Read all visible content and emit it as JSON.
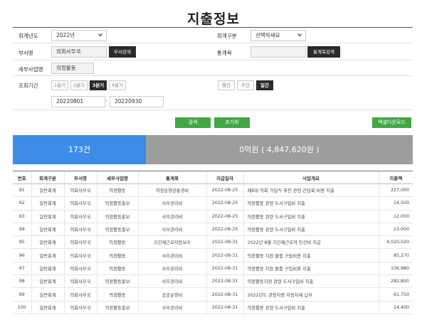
{
  "page_title": "지출정보",
  "filters": {
    "year_label": "회계년도",
    "year_value": "2022년",
    "account_label": "회계구분",
    "account_value": "선택하세요",
    "dept_label": "부서명",
    "dept_value": "의회사무국",
    "dept_search": "부서검색",
    "stat_label": "통계목",
    "stat_value": "",
    "stat_search": "통계목검색",
    "detail_label": "세부사업명",
    "detail_value": "의정활동",
    "period_label": "조회기간",
    "quarters": [
      "1분기",
      "2분기",
      "3분기",
      "4분기"
    ],
    "periods": [
      "월간",
      "주간",
      "일간"
    ],
    "date_from": "20220801",
    "date_sep": "-",
    "date_to": "20220930"
  },
  "actions": {
    "search": "검색",
    "reset": "초기화",
    "excel": "엑셀다운로드"
  },
  "summary": {
    "count": "173건",
    "amount": "0억원 ( 4,847,620원 )"
  },
  "table": {
    "headers": [
      "번호",
      "회계구분",
      "부서명",
      "세부사업명",
      "통계목",
      "지급일자",
      "사업개요",
      "지출액"
    ],
    "rows": [
      [
        "91",
        "일반회계",
        "의회사무국",
        "의정활동",
        "의정운영공통경비",
        "2022-08-25",
        "제6대 의회 가입식 추진 관련 간담회 비용 지출",
        "227,000"
      ],
      [
        "92",
        "일반회계",
        "의회사무국",
        "의정활동홍보",
        "사무관리비",
        "2022-08-25",
        "의정활동 관련 도서구입비 지출",
        "14,500"
      ],
      [
        "93",
        "일반회계",
        "의회사무국",
        "의정활동홍보",
        "사무관리비",
        "2022-08-25",
        "의정활동 관련 도서구입비 지출",
        "12,000"
      ],
      [
        "94",
        "일반회계",
        "의회사무국",
        "의정활동홍보",
        "사무관리비",
        "2022-08-25",
        "의정활동 관련 도서구입비 지출",
        "23,000"
      ],
      [
        "95",
        "일반회계",
        "의회사무국",
        "의정활동",
        "기간제근로자등보수",
        "2022-08-31",
        "2022년 8월 기간제근로자 인건비 지급",
        "4,020,020"
      ],
      [
        "96",
        "일반회계",
        "의회사무국",
        "의정활동",
        "사무관리비",
        "2022-08-31",
        "의정활동 지원 물품 구입비용 지출",
        "85,270"
      ],
      [
        "97",
        "일반회계",
        "의회사무국",
        "의정활동",
        "사무관리비",
        "2022-08-31",
        "의정활동 지원 물품 구입비용 지출",
        "106,880"
      ],
      [
        "98",
        "일반회계",
        "의회사무국",
        "의정활동홍보",
        "사무관리비",
        "2022-08-31",
        "의정활동지원 관련 도서구입비 지출",
        "282,800"
      ],
      [
        "99",
        "일반회계",
        "의회사무국",
        "의정활동",
        "공공운영비",
        "2022-08-31",
        "2022년도 관용차량 자동차세 납부",
        "61,750"
      ],
      [
        "100",
        "일반회계",
        "의회사무국",
        "의정활동홍보",
        "사무관리비",
        "2022-08-31",
        "의정활동 관련 도서구입비 지출",
        "14,400"
      ]
    ]
  }
}
